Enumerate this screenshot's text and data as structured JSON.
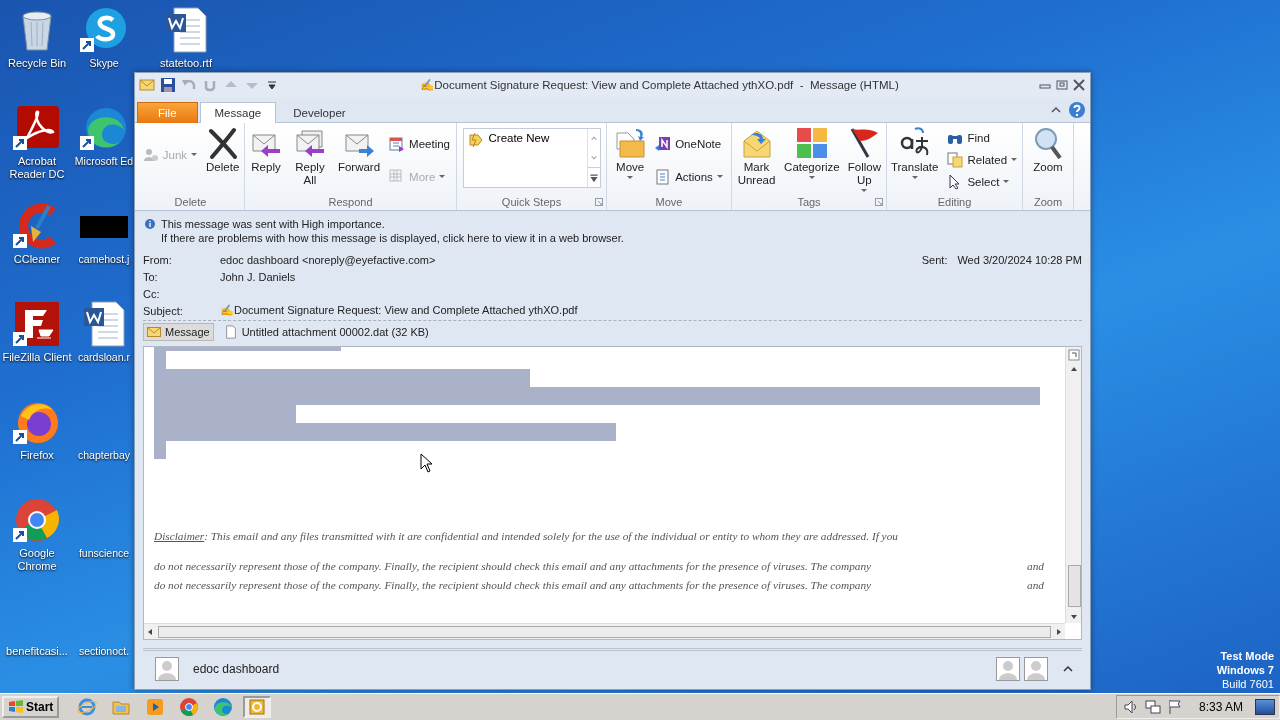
{
  "desktop": {
    "icons": [
      {
        "label": "Recycle Bin"
      },
      {
        "label": "Acrobat Reader DC"
      },
      {
        "label": "CCleaner"
      },
      {
        "label": "FileZilla Client"
      },
      {
        "label": "Firefox"
      },
      {
        "label": "Google Chrome"
      },
      {
        "label": "benefitcasi..."
      },
      {
        "label": "Skype"
      },
      {
        "label": "Microsoft Ed"
      },
      {
        "label": "camehost.j"
      },
      {
        "label": "cardsloan.r"
      },
      {
        "label": "chapterbay"
      },
      {
        "label": "funscience"
      },
      {
        "label": "sectionoct."
      },
      {
        "label": "statetoo.rtf"
      }
    ],
    "notice": [
      "Test Mode",
      "Windows 7",
      "Build 7601"
    ]
  },
  "window": {
    "title": "✍Document Signature Request: View and Complete Attached ythXO.pdf  -  Message (HTML)",
    "tabs": [
      {
        "label": "File",
        "kind": "file",
        "selected": false
      },
      {
        "label": "Message",
        "kind": "tab",
        "selected": true
      },
      {
        "label": "Developer",
        "kind": "tab",
        "selected": false
      }
    ],
    "ribbon": {
      "groups": [
        {
          "label": "Delete",
          "launcher": false,
          "items": [
            {
              "kind": "small",
              "label": "Junk",
              "disabled": true,
              "dropdown": true
            },
            {
              "kind": "large",
              "label": "Delete",
              "disabled": false,
              "dropdown": false
            }
          ]
        },
        {
          "label": "Respond",
          "launcher": false,
          "items": [
            {
              "kind": "large",
              "label": "Reply",
              "disabled": false,
              "dropdown": false
            },
            {
              "kind": "large",
              "label": "Reply All",
              "disabled": false,
              "dropdown": false
            },
            {
              "kind": "large",
              "label": "Forward",
              "disabled": false,
              "dropdown": false
            },
            {
              "kind": "small",
              "label": "Meeting",
              "disabled": false,
              "dropdown": false
            },
            {
              "kind": "small",
              "label": "More",
              "disabled": true,
              "dropdown": true
            }
          ]
        },
        {
          "label": "Quick Steps",
          "launcher": true,
          "items": [
            {
              "kind": "gallery",
              "label": "Create New"
            }
          ]
        },
        {
          "label": "Move",
          "launcher": false,
          "items": [
            {
              "kind": "large",
              "label": "Move",
              "disabled": false,
              "dropdown": true
            },
            {
              "kind": "small",
              "label": "OneNote",
              "disabled": false,
              "dropdown": false
            },
            {
              "kind": "small",
              "label": "Actions",
              "disabled": false,
              "dropdown": true
            }
          ]
        },
        {
          "label": "Tags",
          "launcher": true,
          "items": [
            {
              "kind": "large",
              "label": "Mark Unread",
              "disabled": false,
              "dropdown": false
            },
            {
              "kind": "large",
              "label": "Categorize",
              "disabled": false,
              "dropdown": true
            },
            {
              "kind": "large",
              "label": "Follow Up",
              "disabled": false,
              "dropdown": true
            }
          ]
        },
        {
          "label": "Editing",
          "launcher": false,
          "items": [
            {
              "kind": "large",
              "label": "Translate",
              "disabled": false,
              "dropdown": true
            },
            {
              "kind": "small",
              "label": "Find",
              "disabled": false,
              "dropdown": false
            },
            {
              "kind": "small",
              "label": "Related",
              "disabled": false,
              "dropdown": true
            },
            {
              "kind": "small",
              "label": "Select",
              "disabled": false,
              "dropdown": true
            }
          ]
        },
        {
          "label": "Zoom",
          "launcher": false,
          "items": [
            {
              "kind": "large",
              "label": "Zoom",
              "disabled": false,
              "dropdown": false
            }
          ]
        }
      ]
    },
    "info": [
      "This message was sent with High importance.",
      "If there are problems with how this message is displayed, click here to view it in a web browser."
    ],
    "fields": [
      {
        "label": "From:",
        "value": "edoc dashboard <noreply@eyefactive.com>"
      },
      {
        "label": "To:",
        "value": "John J. Daniels"
      },
      {
        "label": "Cc:"
      },
      {
        "label": "Subject:",
        "value": "✍Document Signature Request: View and Complete Attached ythXO.pdf"
      }
    ],
    "sent": {
      "label": "Sent:",
      "value": "Wed 3/20/2024 10:28 PM"
    },
    "attachments": [
      {
        "label": "Message",
        "kind": "message",
        "selected": true
      },
      {
        "label": "Untitled attachment 00002.dat (32 KB)",
        "kind": "file",
        "selected": false
      }
    ],
    "body": {
      "disclaimer": {
        "label": "Disclaimer",
        "text": ": This email and any files transmitted with it are confidential and intended solely for the use of the individual or entity to whom they are addressed. If you"
      },
      "lines": [
        {
          "text": "do not necessarily represent those of the company. Finally, the recipient should check this email and any attachments for the presence of viruses. The company",
          "tail": "and"
        },
        {
          "text": "do not necessarily represent those of the company. Finally, the recipient should check this email and any attachments for the presence of viruses. The company",
          "tail": "and"
        }
      ]
    },
    "people_pane": {
      "name": "edoc dashboard"
    }
  },
  "taskbar": {
    "start": "Start",
    "apps": [
      {
        "selected": false
      },
      {
        "selected": false
      },
      {
        "selected": false
      },
      {
        "selected": false
      },
      {
        "selected": false
      },
      {
        "selected": true
      }
    ],
    "clock": "8:33 AM"
  }
}
